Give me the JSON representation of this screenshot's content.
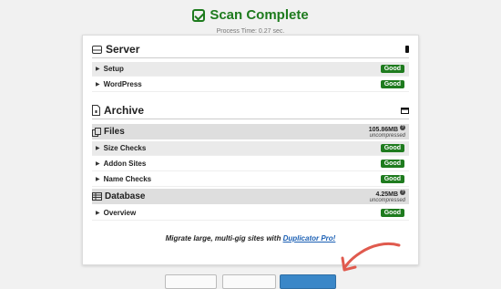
{
  "header": {
    "title": "Scan Complete",
    "subtitle": "Process Time: 0.27 sec."
  },
  "server": {
    "title": "Server",
    "rows": [
      {
        "label": "Setup",
        "status": "Good"
      },
      {
        "label": "WordPress",
        "status": "Good"
      }
    ]
  },
  "archive": {
    "title": "Archive",
    "files": {
      "title": "Files",
      "size": "105.86MB",
      "size_note": "uncompressed",
      "rows": [
        {
          "label": "Size Checks",
          "status": "Good"
        },
        {
          "label": "Addon Sites",
          "status": "Good"
        },
        {
          "label": "Name Checks",
          "status": "Good"
        }
      ]
    },
    "database": {
      "title": "Database",
      "size": "4.25MB",
      "size_note": "uncompressed",
      "rows": [
        {
          "label": "Overview",
          "status": "Good"
        }
      ]
    }
  },
  "promo": {
    "text": "Migrate large, multi-gig sites with",
    "link": "Duplicator Pro!"
  },
  "colors": {
    "success": "#1e7b1e",
    "primary": "#3a87c8",
    "arrow": "#e05a4e"
  }
}
